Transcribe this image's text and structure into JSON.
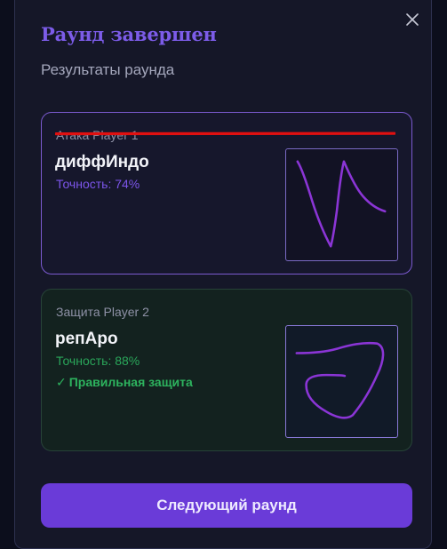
{
  "modal": {
    "title": "Раунд завершен",
    "subtitle": "Результаты раунда",
    "close_icon": "close-icon"
  },
  "attack": {
    "role_label": "Атака Player 1",
    "word": "диффИндо",
    "accuracy": "Точность: 74%",
    "accuracy_value": 0.74,
    "struck_through": true,
    "strike_color": "#e01010",
    "accent_color": "#7c55ea"
  },
  "defense": {
    "role_label": "Защита Player 2",
    "word": "репАро",
    "accuracy": "Точность: 88%",
    "accuracy_value": 0.88,
    "result_icon": "check-icon",
    "result_check": "✓",
    "result_text": "Правильная защита",
    "accent_color": "#2db35e"
  },
  "drawing_color": "#8b35d6",
  "next_button": {
    "label": "Следующий раунд",
    "color": "#6a3bd8"
  }
}
